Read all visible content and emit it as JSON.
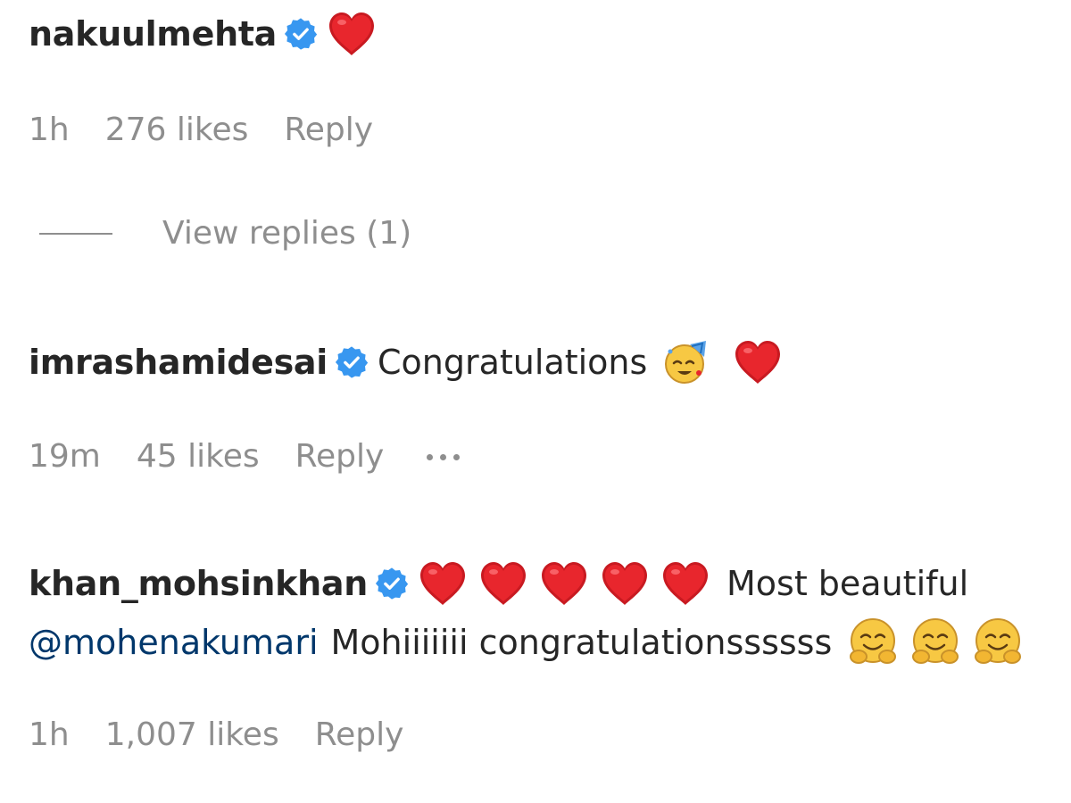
{
  "comments": [
    {
      "username": "nakuulmehta",
      "verified": true,
      "text": "",
      "emojis": [
        "red-heart"
      ],
      "time": "1h",
      "likes": "276 likes",
      "reply_label": "Reply",
      "view_replies": "View replies (1)"
    },
    {
      "username": "imrashamidesai",
      "verified": true,
      "text": "Congratulations",
      "emojis": [
        "face-with-party-horn",
        "red-heart"
      ],
      "time": "19m",
      "likes": "45 likes",
      "reply_label": "Reply",
      "more_icon": "ellipsis"
    },
    {
      "username": "khan_mohsinkhan",
      "verified": true,
      "emojis": [
        "red-heart",
        "red-heart",
        "red-heart",
        "red-heart",
        "red-heart"
      ],
      "text": "Most beautiful",
      "mention": "@mohenakumari",
      "text2": "Mohiiiiiii congratulationssssss",
      "emojis2": [
        "hugging-face",
        "hugging-face",
        "hugging-face"
      ],
      "time": "1h",
      "likes": "1,007 likes",
      "reply_label": "Reply"
    }
  ],
  "colors": {
    "text": "#262626",
    "secondary": "#8e8e8e",
    "verified": "#3897f0",
    "mention": "#00376b",
    "heart": "#e0242b"
  }
}
